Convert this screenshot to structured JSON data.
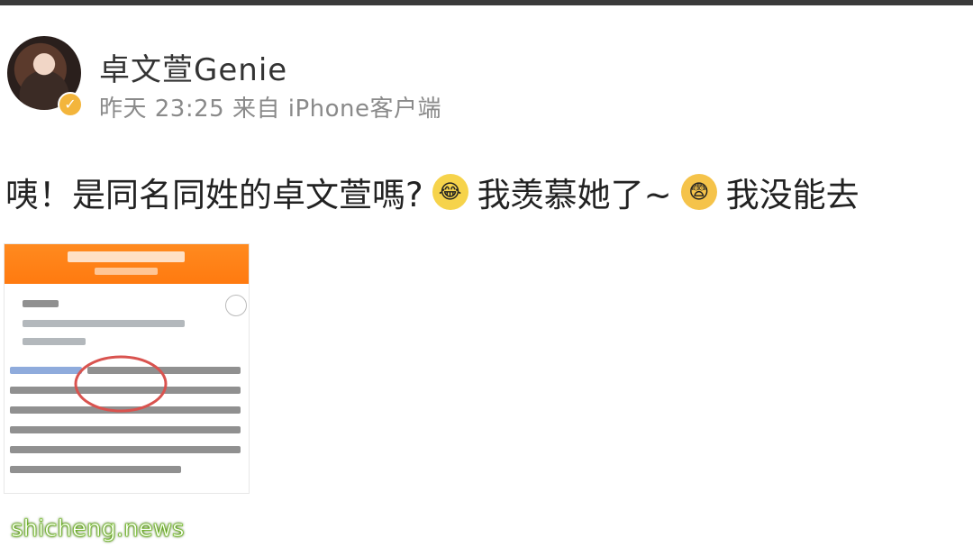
{
  "post": {
    "author": "卓文萱Genie",
    "meta": "昨天 23:25 来自 iPhone客户端",
    "text_part1": "咦！是同名同姓的卓文萱嗎?",
    "text_part2": "我羡慕她了~",
    "text_part3": "我没能去",
    "emojis": [
      "crying-laughing-emoji",
      "scared-emoji"
    ]
  },
  "watermark": "shicheng.news",
  "colors": {
    "banner": "#ff7a10",
    "verified_badge": "#f3b53c",
    "meta_text": "#8a8a8a",
    "circle_annotation": "#d9534f"
  }
}
